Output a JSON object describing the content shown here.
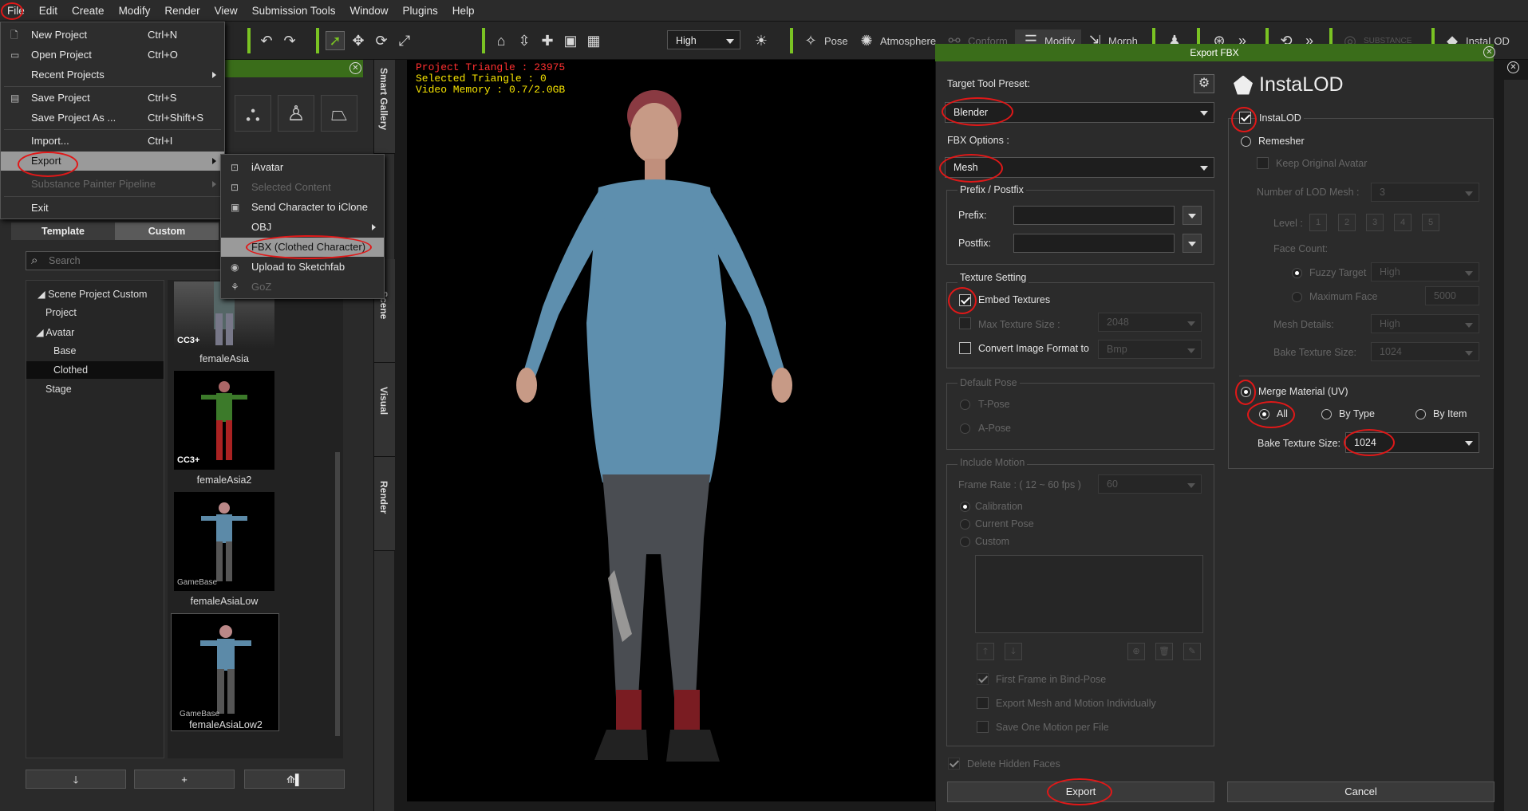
{
  "menubar": {
    "items": [
      "File",
      "Edit",
      "Create",
      "Modify",
      "Render",
      "View",
      "Submission Tools",
      "Window",
      "Plugins",
      "Help"
    ]
  },
  "toolbar": {
    "quality": "High",
    "pose": "Pose",
    "atmosphere": "Atmosphere",
    "conform": "Conform",
    "modify": "Modify",
    "morph": "Morph",
    "substance": "SUBSTANCE",
    "instalod": "InstaLOD"
  },
  "file_menu": [
    {
      "label": "New Project",
      "shortcut": "Ctrl+N",
      "icon": "new-file-icon"
    },
    {
      "label": "Open Project",
      "shortcut": "Ctrl+O",
      "icon": "folder-icon"
    },
    {
      "label": "Recent Projects",
      "shortcut": "",
      "icon": ""
    },
    {
      "label": "Save Project",
      "shortcut": "Ctrl+S",
      "icon": "save-icon"
    },
    {
      "label": "Save Project As ...",
      "shortcut": "Ctrl+Shift+S",
      "icon": ""
    },
    {
      "label": "Import...",
      "shortcut": "Ctrl+I",
      "icon": ""
    },
    {
      "label": "Export",
      "shortcut": "",
      "icon": ""
    },
    {
      "label": "Substance Painter Pipeline",
      "shortcut": "",
      "icon": ""
    },
    {
      "label": "Exit",
      "shortcut": "",
      "icon": ""
    }
  ],
  "export_submenu": [
    {
      "label": "iAvatar"
    },
    {
      "label": "Selected Content"
    },
    {
      "label": "Send Character to iClone"
    },
    {
      "label": "OBJ"
    },
    {
      "label": "FBX (Clothed Character)"
    },
    {
      "label": "Upload to Sketchfab"
    },
    {
      "label": "GoZ"
    }
  ],
  "left_panel": {
    "tabs": [
      "Template",
      "Custom"
    ],
    "search_placeholder": "Search",
    "tree": [
      "Scene Project Custom",
      "Project",
      "Avatar",
      "Base",
      "Clothed",
      "Stage"
    ],
    "thumbnails": [
      {
        "name": "femaleAsia",
        "badge": "CC3+"
      },
      {
        "name": "femaleAsia2",
        "badge": "CC3+"
      },
      {
        "name": "femaleAsiaLow",
        "badge": "GameBase"
      },
      {
        "name": "femaleAsiaLow2",
        "badge": "GameBase"
      }
    ]
  },
  "side_tabs": [
    "Smart Gallery",
    "Scene",
    "Visual",
    "Render"
  ],
  "viewport": {
    "project_triangle": "Project Triangle : 23975",
    "selected_triangle": "Selected Triangle : 0",
    "video_memory": "Video Memory : 0.7/2.0GB"
  },
  "export_dialog": {
    "title": "Export FBX",
    "target_tool_label": "Target Tool Preset:",
    "target_tool_value": "Blender",
    "fbx_options_label": "FBX Options :",
    "fbx_options_value": "Mesh",
    "prefix_postfix_group": "Prefix / Postfix",
    "prefix_label": "Prefix:",
    "postfix_label": "Postfix:",
    "texture_group": "Texture Setting",
    "embed_textures": "Embed Textures",
    "max_texture_size": "Max Texture Size :",
    "max_texture_value": "2048",
    "convert_image": "Convert Image Format to",
    "convert_value": "Bmp",
    "default_pose_group": "Default Pose",
    "t_pose": "T-Pose",
    "a_pose": "A-Pose",
    "include_motion_group": "Include Motion",
    "frame_rate_label": "Frame Rate : ( 12 ~ 60 fps )",
    "frame_rate_value": "60",
    "calibration": "Calibration",
    "current_pose": "Current Pose",
    "custom": "Custom",
    "first_frame": "First Frame in Bind-Pose",
    "export_individually": "Export Mesh and Motion Individually",
    "save_one_motion": "Save One Motion per File",
    "delete_hidden": "Delete Hidden Faces",
    "export_button": "Export",
    "cancel_button": "Cancel"
  },
  "instalod": {
    "logo": "InstaLOD",
    "instalod_check": "InstaLOD",
    "remesher": "Remesher",
    "keep_original": "Keep Original Avatar",
    "num_lod_label": "Number of LOD Mesh :",
    "num_lod_value": "3",
    "level_label": "Level :",
    "levels": [
      "1",
      "2",
      "3",
      "4",
      "5"
    ],
    "face_count": "Face Count:",
    "fuzzy_target": "Fuzzy Target",
    "fuzzy_value": "High",
    "maximum_face": "Maximum Face",
    "maximum_face_value": "5000",
    "mesh_details": "Mesh Details:",
    "mesh_details_value": "High",
    "bake_size_label1": "Bake Texture Size:",
    "bake_size_value1": "1024",
    "merge_material": "Merge Material (UV)",
    "all": "All",
    "by_type": "By Type",
    "by_item": "By Item",
    "bake_size_label2": "Bake Texture Size:",
    "bake_size_value2": "1024"
  },
  "colors": {
    "accent_green": "#7ac323",
    "title_green": "#3a6d1a",
    "annotation_red": "#e01818",
    "viewport_text": "#f7e400",
    "triangle_red": "#ff3030"
  }
}
